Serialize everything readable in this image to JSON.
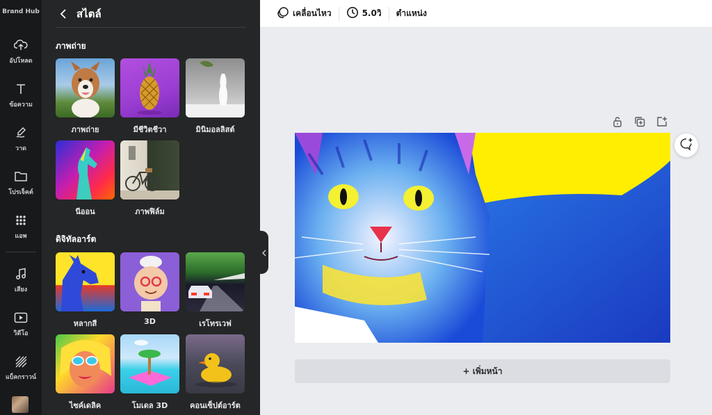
{
  "rail": {
    "items": [
      {
        "label": "Brand Hub",
        "icon": "brand-hub-icon"
      },
      {
        "label": "อัปโหลด",
        "icon": "upload-icon"
      },
      {
        "label": "ข้อความ",
        "icon": "text-icon"
      },
      {
        "label": "วาด",
        "icon": "draw-icon"
      },
      {
        "label": "โปรเจ็คต์",
        "icon": "folder-icon"
      },
      {
        "label": "แอพ",
        "icon": "apps-icon"
      },
      {
        "label": "เสียง",
        "icon": "music-icon"
      },
      {
        "label": "วิดีโอ",
        "icon": "video-icon"
      },
      {
        "label": "แบ็คกราวน์",
        "icon": "background-icon"
      }
    ]
  },
  "panel": {
    "title": "สไตล์",
    "sections": [
      {
        "title": "ภาพถ่าย",
        "tiles": [
          "ภาพถ่าย",
          "มีชีวิตชีวา",
          "มินิมอลลิสต์",
          "นีออน",
          "ภาพฟิล์ม"
        ]
      },
      {
        "title": "ดิจิทัลอาร์ต",
        "tiles": [
          "หลากสี",
          "3D",
          "เรโทรเวฟ",
          "ไซค์เดลิค",
          "โมเดล 3D",
          "คอนเซ็ปต์อาร์ต"
        ]
      }
    ]
  },
  "toolbar": {
    "animate": "เคลื่อนไหว",
    "duration": "5.0วิ",
    "position": "ตำแหน่ง"
  },
  "canvas": {
    "add_page": "+ เพิ่มหน้า"
  },
  "colors": {
    "rail_bg": "#18191b",
    "panel_bg": "#252627",
    "canvas_bg": "#ebecf0"
  }
}
